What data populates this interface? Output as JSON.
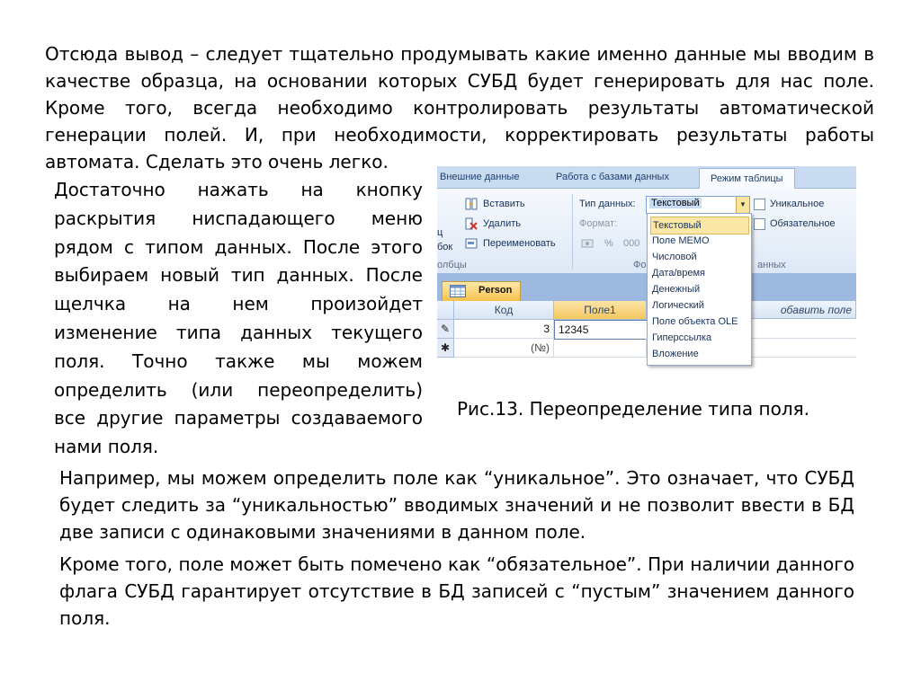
{
  "text": {
    "p1": "Отсюда вывод – следует тщательно продумывать какие именно данные мы вводим в качестве образца, на основании которых СУБД будет генерировать для нас поле. Кроме того, всегда необходимо контролировать результаты автоматической генерации полей. И, при необходимости, корректировать результаты работы автомата. Сделать это очень легко.",
    "p2": "Достаточно нажать на кнопку раскрытия ниспадающего меню рядом с типом данных. После этого выбираем новый тип данных. После щелчка на нем произойдет изменение типа данных текущего поля. Точно также мы можем определить (или переопределить) все другие параметры создаваемого нами поля.",
    "caption": "Рис.13. Переопределение типа поля.",
    "p3": "Например, мы можем определить поле как “уникальное”. Это означает, что СУБД будет следить за “уникальностью” вводимых значений и не позволит ввести в БД две записи с одинаковыми значениями в данном поле.",
    "p4": "Кроме того, поле может быть помечено как “обязательное”. При наличии данного флага СУБД гарантирует отсутствие в БД записей с “пустым” значением данного поля."
  },
  "screenshot": {
    "tabs": [
      "Внешние данные",
      "Работа с базами данных",
      "Режим таблицы"
    ],
    "ribbon": {
      "insert": "Вставить",
      "delete": "Удалить",
      "rename": "Переименовать",
      "left_fragment_1": "ц",
      "left_fragment_2": "бок",
      "group_fields": "олбцы",
      "datatype_label": "Тип данных:",
      "datatype_value": "Текстовый",
      "format_label": "Формат:",
      "percent": "%",
      "zeros": "000",
      "unique": "Уникальное",
      "required": "Обязательное",
      "group_fo": "Фо",
      "group_data": "анных"
    },
    "doc_tab": "Person",
    "columns": [
      "Код",
      "Поле1",
      "обавить поле"
    ],
    "rows": [
      {
        "selector": "✎",
        "id": "3",
        "field1": "12345"
      },
      {
        "selector": "✱",
        "id": "(№)",
        "field1": ""
      }
    ],
    "dropdown": [
      "Текстовый",
      "Поле MEMO",
      "Числовой",
      "Дата/время",
      "Денежный",
      "Логический",
      "Поле объекта OLE",
      "Гиперссылка",
      "Вложение"
    ],
    "dropdown_selected": "Текстовый"
  }
}
